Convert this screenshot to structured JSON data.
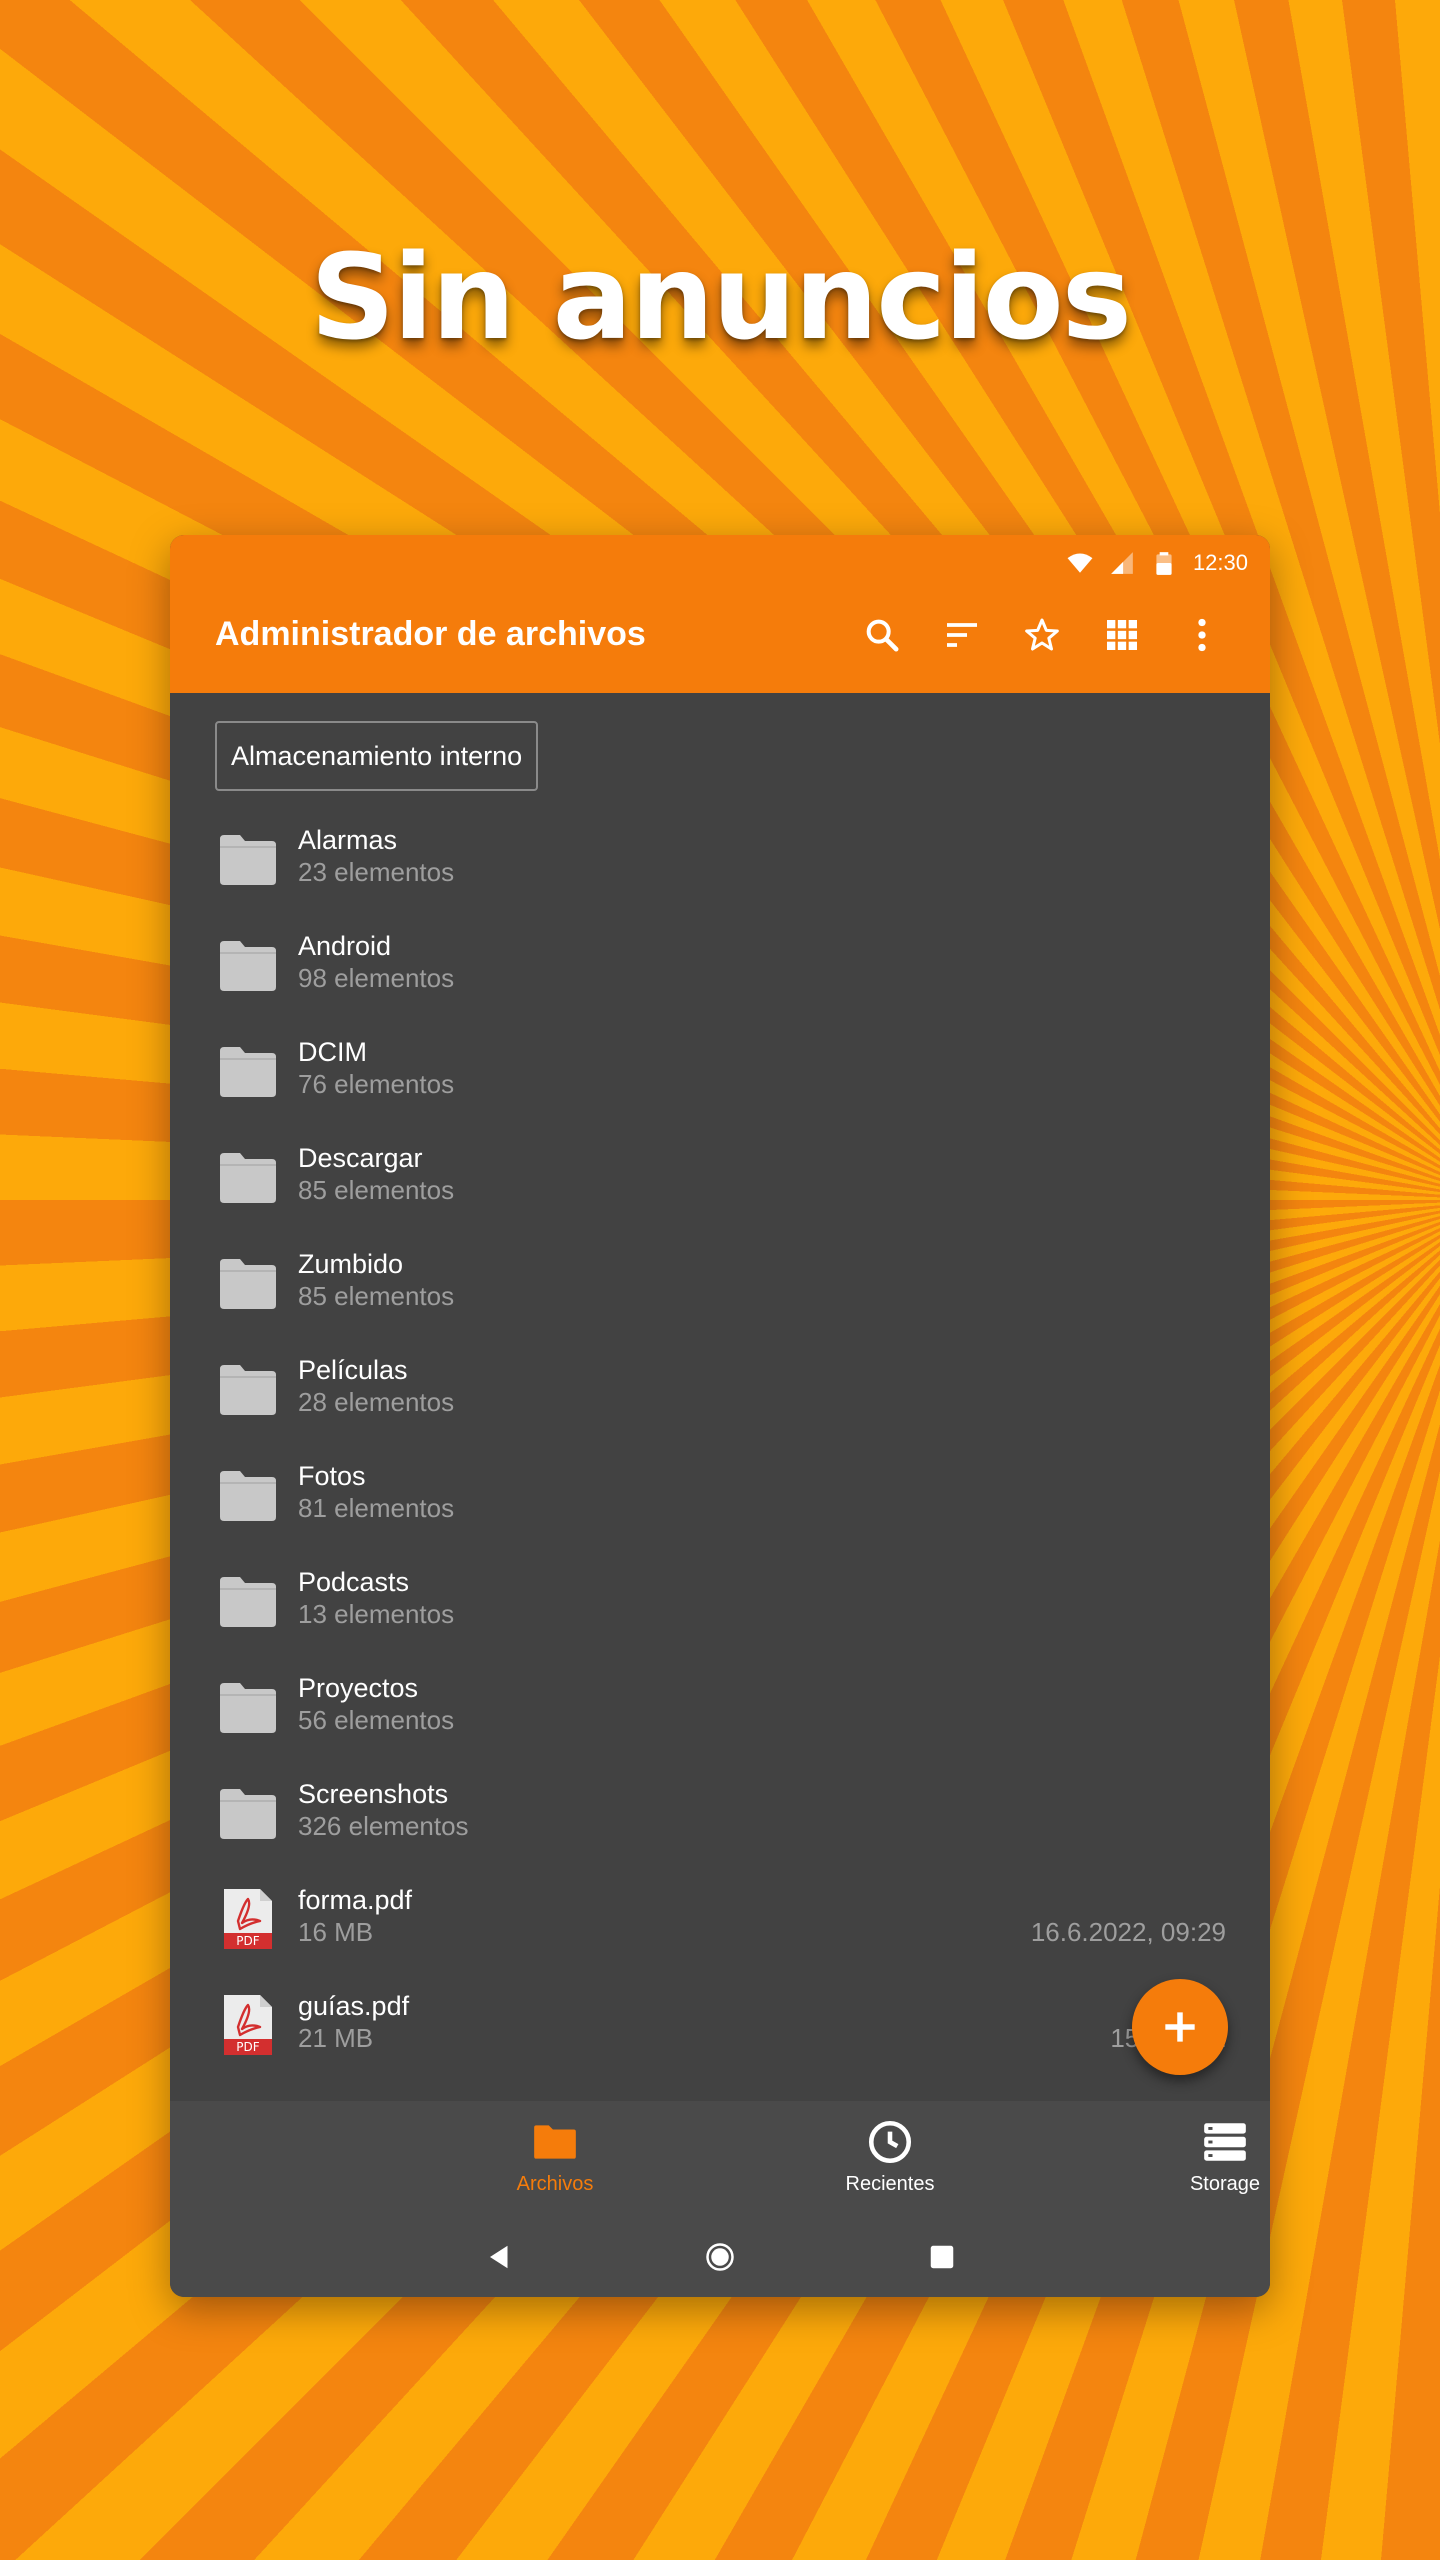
{
  "headline": "Sin anuncios",
  "status_bar": {
    "time": "12:30"
  },
  "toolbar": {
    "title": "Administrador de archivos",
    "actions": [
      "search-icon",
      "sort-icon",
      "star-icon",
      "grid-view-icon",
      "more-vert-icon"
    ]
  },
  "breadcrumb": "Almacenamiento interno",
  "files": [
    {
      "name": "Alarmas",
      "info": "23 elementos",
      "type": "folder"
    },
    {
      "name": "Android",
      "info": "98 elementos",
      "type": "folder"
    },
    {
      "name": "DCIM",
      "info": "76 elementos",
      "type": "folder"
    },
    {
      "name": "Descargar",
      "info": "85 elementos",
      "type": "folder"
    },
    {
      "name": "Zumbido",
      "info": "85 elementos",
      "type": "folder"
    },
    {
      "name": "Películas",
      "info": "28 elementos",
      "type": "folder"
    },
    {
      "name": "Fotos",
      "info": "81 elementos",
      "type": "folder"
    },
    {
      "name": "Podcasts",
      "info": "13 elementos",
      "type": "folder"
    },
    {
      "name": "Proyectos",
      "info": "56 elementos",
      "type": "folder"
    },
    {
      "name": "Screenshots",
      "info": "326 elementos",
      "type": "folder"
    },
    {
      "name": "forma.pdf",
      "info": "16 MB",
      "date": "16.6.2022, 09:29",
      "type": "pdf"
    },
    {
      "name": "guías.pdf",
      "info": "21 MB",
      "date": "15.6.2022",
      "type": "pdf"
    }
  ],
  "bottom_nav": [
    {
      "label": "Archivos",
      "icon": "folder-icon",
      "active": true
    },
    {
      "label": "Recientes",
      "icon": "clock-icon",
      "active": false
    },
    {
      "label": "Storage",
      "icon": "storage-icon",
      "active": false
    }
  ],
  "colors": {
    "accent": "#f57c0b",
    "background": "#424242",
    "bottom_bar": "#4a4a4a",
    "folder": "#c8c8c8",
    "secondary_text": "#9e9e9e"
  }
}
